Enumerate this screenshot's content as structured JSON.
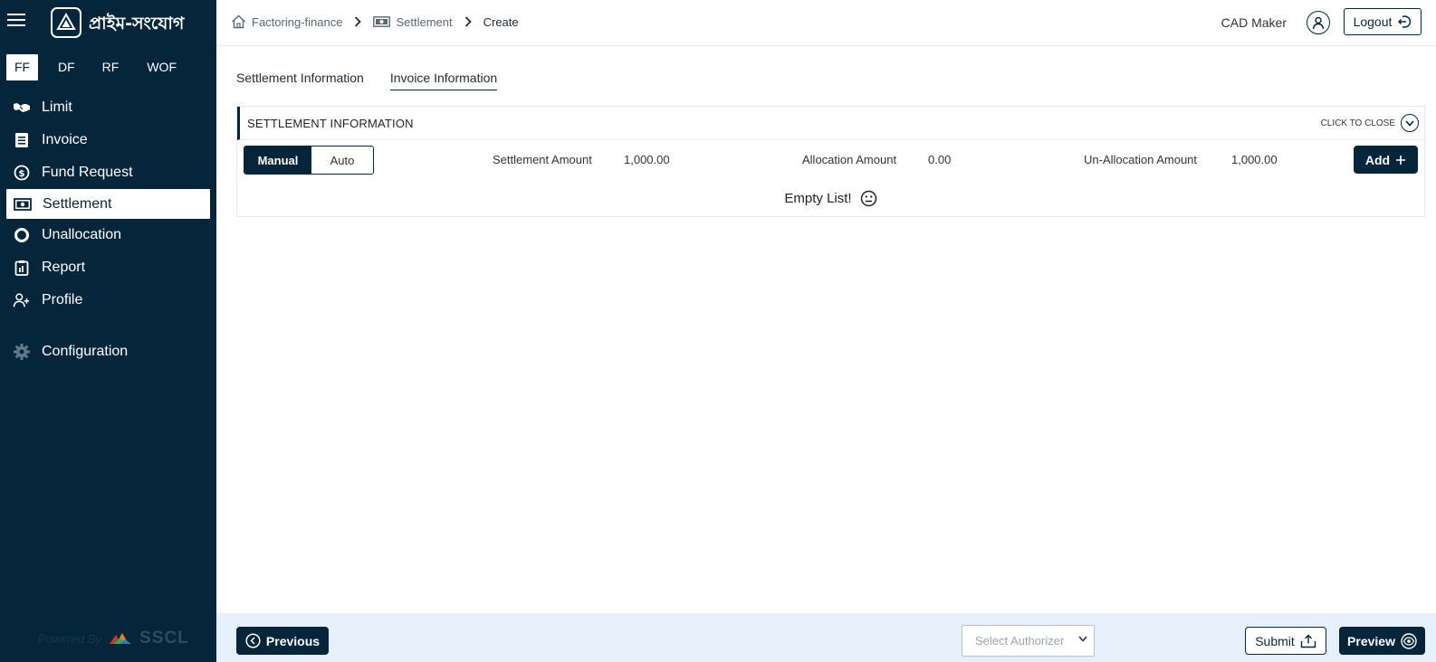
{
  "brand": {
    "name": "প্রাইম-সংযোগ"
  },
  "sidebar": {
    "type_tabs": [
      {
        "label": "FF",
        "active": true
      },
      {
        "label": "DF",
        "active": false
      },
      {
        "label": "RF",
        "active": false
      },
      {
        "label": "WOF",
        "active": false
      }
    ],
    "items": [
      {
        "label": "Limit",
        "icon": "handshake-icon"
      },
      {
        "label": "Invoice",
        "icon": "invoice-icon"
      },
      {
        "label": "Fund Request",
        "icon": "dollar-coin-icon"
      },
      {
        "label": "Settlement",
        "icon": "cash-icon",
        "active": true
      },
      {
        "label": "Unallocation",
        "icon": "ring-icon"
      },
      {
        "label": "Report",
        "icon": "clipboard-icon"
      },
      {
        "label": "Profile",
        "icon": "user-plus-icon"
      },
      {
        "label": "Configuration",
        "icon": "gear-icon"
      }
    ],
    "powered_by": "Powered By",
    "powered_brand": "SSCL"
  },
  "header": {
    "breadcrumb": [
      "Factoring-finance",
      "Settlement",
      "Create"
    ],
    "user_name": "CAD Maker",
    "logout_label": "Logout"
  },
  "tabs": [
    {
      "label": "Settlement Information",
      "active": false
    },
    {
      "label": "Invoice Information",
      "active": true
    }
  ],
  "panel": {
    "title": "SETTLEMENT INFORMATION",
    "click_to_close": "CLICK TO CLOSE",
    "mode": {
      "manual": "Manual",
      "auto": "Auto",
      "selected": "Manual"
    },
    "settlement_amount_label": "Settlement Amount",
    "settlement_amount": "1,000.00",
    "allocation_amount_label": "Allocation Amount",
    "allocation_amount": "0.00",
    "unallocation_amount_label": "Un-Allocation Amount",
    "unallocation_amount": "1,000.00",
    "add_label": "Add",
    "empty_text": "Empty List!"
  },
  "footer": {
    "previous_label": "Previous",
    "authorizer_placeholder": "Select Authorizer",
    "submit_label": "Submit",
    "preview_label": "Preview"
  },
  "colors": {
    "sidebar_bg": "#05263a",
    "accent": "#05263a",
    "footer_bg": "#e5f0fa"
  }
}
